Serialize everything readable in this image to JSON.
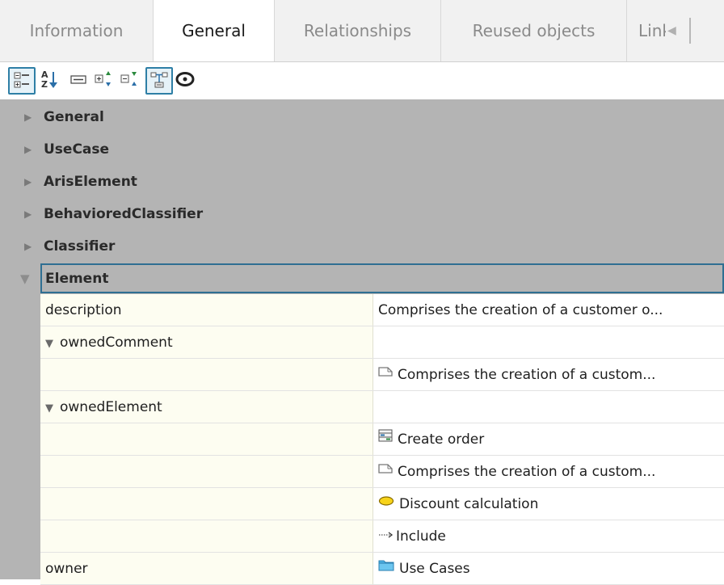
{
  "tabs": [
    {
      "label": "Information",
      "active": false
    },
    {
      "label": "General",
      "active": true
    },
    {
      "label": "Relationships",
      "active": false
    },
    {
      "label": "Reused objects",
      "active": false
    },
    {
      "label": "Link",
      "active": false
    }
  ],
  "toolbar": {
    "buttons": [
      {
        "icon": "categorized-view-icon",
        "pressed": true
      },
      {
        "icon": "sort-alphabetical-icon",
        "pressed": false
      },
      {
        "icon": "show-attributes-icon",
        "pressed": false
      },
      {
        "icon": "expand-all-icon",
        "pressed": false
      },
      {
        "icon": "collapse-all-icon",
        "pressed": false
      },
      {
        "icon": "show-hierarchy-icon",
        "pressed": true
      },
      {
        "icon": "eye-icon",
        "pressed": false
      }
    ]
  },
  "categories": [
    {
      "label": "General",
      "expanded": false
    },
    {
      "label": "UseCase",
      "expanded": false
    },
    {
      "label": "ArisElement",
      "expanded": false
    },
    {
      "label": "BehavioredClassifier",
      "expanded": false
    },
    {
      "label": "Classifier",
      "expanded": false
    },
    {
      "label": "Element",
      "expanded": true
    }
  ],
  "rows": [
    {
      "name": "description",
      "value": "Comprises the creation of a customer o...",
      "icon": "",
      "expander": false
    },
    {
      "name": "ownedComment",
      "value": "",
      "icon": "",
      "expander": true
    },
    {
      "name": "",
      "value": "Comprises the creation of a custom...",
      "icon": "comment-icon",
      "expander": false
    },
    {
      "name": "ownedElement",
      "value": "",
      "icon": "",
      "expander": true
    },
    {
      "name": "",
      "value": "Create order",
      "icon": "class-icon",
      "expander": false
    },
    {
      "name": "",
      "value": "Comprises the creation of a custom...",
      "icon": "comment-icon",
      "expander": false
    },
    {
      "name": "",
      "value": "Discount calculation",
      "icon": "use-case-icon",
      "expander": false
    },
    {
      "name": "",
      "value": "Include",
      "icon": "include-arrow-icon",
      "expander": false
    },
    {
      "name": "owner",
      "value": "Use Cases",
      "icon": "folder-icon",
      "expander": false
    }
  ],
  "colors": {
    "tabbar_bg": "#f1f1f1",
    "category_bg": "#b4b4b4",
    "name_cell_bg": "#fdfdf1",
    "selection_border": "#2f6f92",
    "toolbar_pressed": "#2e7fa6"
  }
}
